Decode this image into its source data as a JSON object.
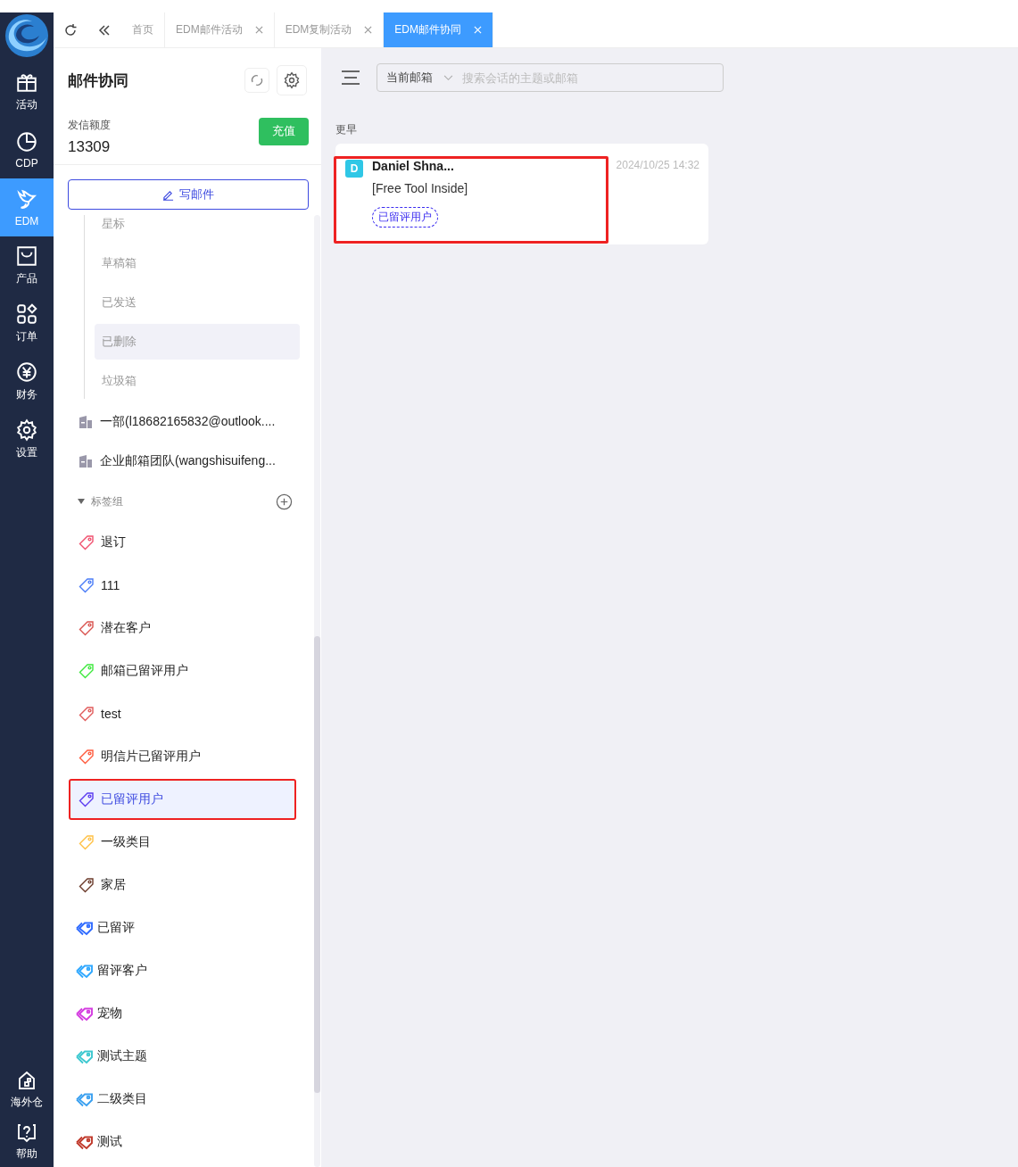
{
  "nav": {
    "items": [
      {
        "label": "活动",
        "selected": false
      },
      {
        "label": "CDP",
        "selected": false
      },
      {
        "label": "EDM",
        "selected": true
      },
      {
        "label": "产品",
        "selected": false
      },
      {
        "label": "订单",
        "selected": false
      },
      {
        "label": "财务",
        "selected": false
      },
      {
        "label": "设置",
        "selected": false
      }
    ],
    "bottom_items": [
      {
        "label": "海外仓",
        "selected": false
      },
      {
        "label": "帮助",
        "selected": false
      }
    ]
  },
  "tabs": [
    {
      "label": "首页",
      "selected": false,
      "closable": false
    },
    {
      "label": "EDM邮件活动",
      "selected": false,
      "closable": true
    },
    {
      "label": "EDM复制活动",
      "selected": false,
      "closable": true
    },
    {
      "label": "EDM邮件协同",
      "selected": true,
      "closable": true
    }
  ],
  "panel": {
    "title": "邮件协同",
    "quota_label": "发信额度",
    "quota_value": "13309",
    "recharge_button": "充值",
    "compose_button": "写邮件",
    "folders": [
      {
        "label": "星标",
        "selected": false
      },
      {
        "label": "草稿箱",
        "selected": false
      },
      {
        "label": "已发送",
        "selected": false
      },
      {
        "label": "已删除",
        "selected": true
      },
      {
        "label": "垃圾箱",
        "selected": false
      }
    ],
    "accounts": [
      {
        "label": "一部(l18682165832@outlook...."
      },
      {
        "label": "企业邮箱团队(wangshisuifeng..."
      }
    ],
    "tag_group": {
      "label": "标签组",
      "expanded": true
    },
    "tags": [
      {
        "label": "退订",
        "kind": "single",
        "color": "#f0506e",
        "selected": false,
        "annotated": false
      },
      {
        "label": "111",
        "kind": "single",
        "color": "#4a7cf7",
        "selected": false,
        "annotated": false
      },
      {
        "label": "潜在客户",
        "kind": "single",
        "color": "#d9534f",
        "selected": false,
        "annotated": false
      },
      {
        "label": "邮箱已留评用户",
        "kind": "single",
        "color": "#3de83d",
        "selected": false,
        "annotated": false
      },
      {
        "label": "test",
        "kind": "single",
        "color": "#e05a5a",
        "selected": false,
        "annotated": false
      },
      {
        "label": "明信片已留评用户",
        "kind": "single",
        "color": "#ff5a3c",
        "selected": false,
        "annotated": false
      },
      {
        "label": "已留评用户",
        "kind": "single",
        "color": "#5b3cf0",
        "selected": true,
        "annotated": true
      },
      {
        "label": "一级类目",
        "kind": "single",
        "color": "#ffc043",
        "selected": false,
        "annotated": false
      },
      {
        "label": "家居",
        "kind": "single",
        "color": "#6b3a2a",
        "selected": false,
        "annotated": false
      },
      {
        "label": "已留评",
        "kind": "double",
        "color": "#2f6bff",
        "selected": false,
        "annotated": false
      },
      {
        "label": "留评客户",
        "kind": "double",
        "color": "#2fa8ff",
        "selected": false,
        "annotated": false
      },
      {
        "label": "宠物",
        "kind": "double",
        "color": "#d43ce0",
        "selected": false,
        "annotated": false
      },
      {
        "label": "测试主题",
        "kind": "double",
        "color": "#3cc8d0",
        "selected": false,
        "annotated": false
      },
      {
        "label": "二级类目",
        "kind": "double",
        "color": "#3aa0f0",
        "selected": false,
        "annotated": false
      },
      {
        "label": "测试",
        "kind": "double",
        "color": "#c0392b",
        "selected": false,
        "annotated": false
      }
    ]
  },
  "mail_list": {
    "mailbox_select": "当前邮箱",
    "search": {
      "placeholder": "搜索会话的主题或邮箱"
    },
    "group_label": "更早",
    "mails": [
      {
        "avatar": "D",
        "sender": "Daniel Shna...",
        "subject": "[Free Tool Inside]",
        "tag": "已留评用户",
        "date": "2024/10/25 14:32",
        "annotated": true
      }
    ]
  }
}
